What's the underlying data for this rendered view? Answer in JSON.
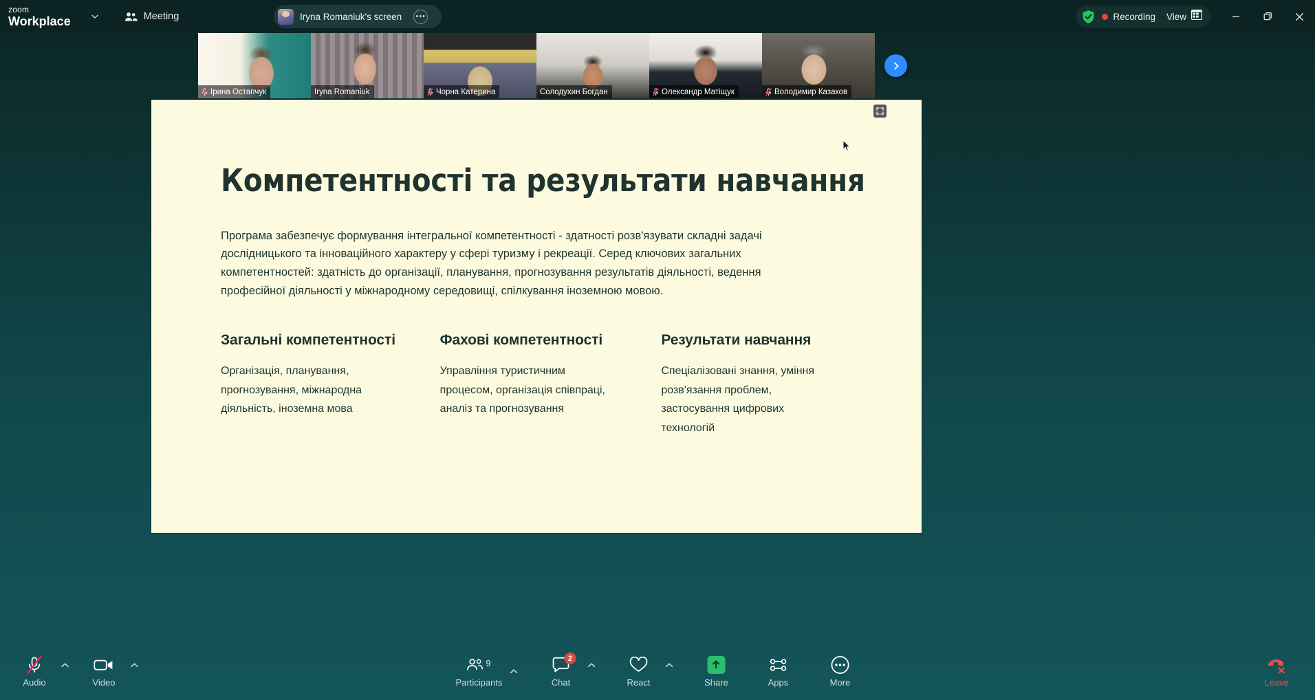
{
  "titlebar": {
    "brand_top": "zoom",
    "brand_bottom": "Workplace",
    "brand_caret_icon": "chevron-down-icon",
    "meeting_label": "Meeting",
    "meeting_icon": "people-icon",
    "screen_share_label": "Iryna Romaniuk's screen",
    "screen_more_label": "•••",
    "shield_icon": "security-shield-icon",
    "recording_label": "Recording",
    "view_label": "View",
    "view_icon": "layout-grid-icon",
    "minimize_icon": "minimize-icon",
    "restore_icon": "restore-window-icon",
    "close_icon": "close-icon"
  },
  "strip": {
    "next_icon": "chevron-right-icon",
    "tiles": [
      {
        "name": "Ірина Остапчук",
        "muted": true,
        "active": false,
        "photo": "ph1"
      },
      {
        "name": "Iryna Romaniuk",
        "muted": false,
        "active": true,
        "photo": "ph2"
      },
      {
        "name": "Чорна Катерина",
        "muted": true,
        "active": false,
        "photo": "ph3"
      },
      {
        "name": "Солодухин Богдан",
        "muted": false,
        "active": false,
        "photo": "ph4"
      },
      {
        "name": "Олександр Матіщук",
        "muted": true,
        "active": false,
        "photo": "ph5"
      },
      {
        "name": "Володимир Казаков",
        "muted": true,
        "active": false,
        "photo": "ph6"
      }
    ]
  },
  "slide": {
    "title": "Компетентності та результати навчання",
    "intro": "Програма забезпечує формування інтегральної компетентності - здатності розв'язувати складні задачі дослідницького та інноваційного характеру у сфері туризму і рекреації. Серед ключових загальних компетентностей: здатність до організації, планування, прогнозування результатів діяльності, ведення професійної діяльності у міжнародному середовищі, спілкування іноземною мовою.",
    "columns": [
      {
        "heading": "Загальні компетентності",
        "text": "Організація, планування, прогнозування, міжнародна діяльність, іноземна мова"
      },
      {
        "heading": "Фахові компетентності",
        "text": "Управління туристичним процесом, організація співпраці, аналіз та прогнозування"
      },
      {
        "heading": "Результати навчання",
        "text": "Спеціалізовані знання, уміння розв'язання проблем, застосування цифрових технологій"
      }
    ],
    "background_color": "#fdfbdf",
    "text_color": "#1f3530",
    "exit_fullscreen_icon": "exit-fullscreen-icon"
  },
  "toolbar": {
    "audio": {
      "label": "Audio",
      "icon": "microphone-muted-icon",
      "caret_icon": "chevron-up-icon"
    },
    "video": {
      "label": "Video",
      "icon": "camera-icon",
      "caret_icon": "chevron-up-icon"
    },
    "participants": {
      "label": "Participants",
      "icon": "participants-icon",
      "count": "9"
    },
    "chat": {
      "label": "Chat",
      "icon": "chat-icon",
      "badge": "2",
      "caret_icon": "chevron-up-icon"
    },
    "react": {
      "label": "React",
      "icon": "heart-icon",
      "caret_icon": "chevron-up-icon"
    },
    "share": {
      "label": "Share",
      "icon": "share-screen-icon",
      "accent": "#2bbf6a"
    },
    "apps": {
      "label": "Apps",
      "icon": "apps-icon"
    },
    "more": {
      "label": "More",
      "icon": "more-dots-icon"
    },
    "leave": {
      "label": "Leave",
      "icon": "leave-meeting-icon",
      "color": "#e8504a"
    }
  }
}
